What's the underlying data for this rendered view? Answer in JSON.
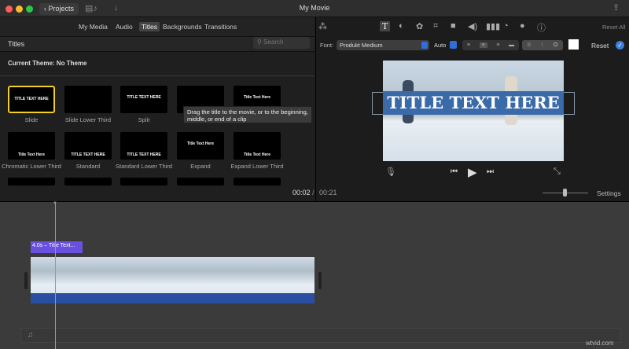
{
  "window": {
    "title": "My Movie",
    "back_label": "Projects"
  },
  "tabs": [
    {
      "label": "My Media"
    },
    {
      "label": "Audio"
    },
    {
      "label": "Titles"
    },
    {
      "label": "Backgrounds"
    },
    {
      "label": "Transitions"
    }
  ],
  "browser": {
    "header": "Titles",
    "search_placeholder": "Search",
    "theme": "Current Theme: No Theme",
    "titles": [
      {
        "label": "Slide",
        "preview": "TITLE TEXT HERE"
      },
      {
        "label": "Slide Lower Third",
        "preview": ""
      },
      {
        "label": "Split",
        "preview": "TITLE TEXT HERE"
      },
      {
        "label": "S",
        "preview": ""
      },
      {
        "label": "",
        "preview": "Title Text Here"
      },
      {
        "label": "Chromatic Lower Third",
        "preview": "Title Text Here"
      },
      {
        "label": "Standard",
        "preview": "TITLE TEXT HERE"
      },
      {
        "label": "Standard Lower Third",
        "preview": "TITLE TEXT HERE"
      },
      {
        "label": "Expand",
        "preview": "Title Text Here"
      },
      {
        "label": "Expand Lower Third",
        "preview": "Title Text Here"
      }
    ],
    "tooltip": "Drag the title to the movie, or to the beginning, middle, or end of a clip"
  },
  "viewer": {
    "reset_all": "Reset All",
    "font_label": "Font:",
    "font": "Produkt Medium",
    "size": "Auto",
    "reset": "Reset",
    "title_text": "TITLE TEXT HERE",
    "timecode": "00:02",
    "duration": "00:21",
    "settings": "Settings",
    "color": "#ffffff"
  },
  "timeline": {
    "title_clip": "4.0s – Title Text..."
  },
  "watermark": "wtvid.com"
}
